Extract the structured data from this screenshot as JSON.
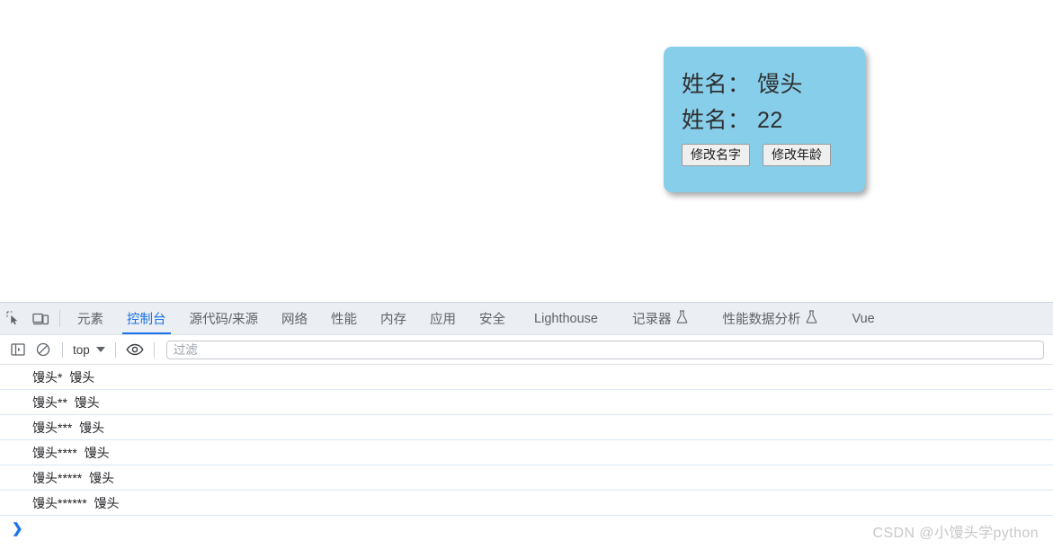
{
  "page": {
    "card": {
      "name_line": "姓名： 馒头",
      "age_line": "姓名： 22",
      "bg_color": "#87ceeb",
      "buttons": [
        {
          "label": "修改名字",
          "name": "change-name-button"
        },
        {
          "label": "修改年龄",
          "name": "change-age-button"
        }
      ]
    }
  },
  "devtools": {
    "toolbar_icons": [
      {
        "name": "inspect-element-icon"
      },
      {
        "name": "device-toolbar-icon"
      }
    ],
    "tabs": [
      {
        "label": "元素",
        "active": false,
        "flask": false
      },
      {
        "label": "控制台",
        "active": true,
        "flask": false
      },
      {
        "label": "源代码/来源",
        "active": false,
        "flask": false
      },
      {
        "label": "网络",
        "active": false,
        "flask": false
      },
      {
        "label": "性能",
        "active": false,
        "flask": false
      },
      {
        "label": "内存",
        "active": false,
        "flask": false
      },
      {
        "label": "应用",
        "active": false,
        "flask": false
      },
      {
        "label": "安全",
        "active": false,
        "flask": false
      },
      {
        "label": "Lighthouse",
        "active": false,
        "flask": false
      },
      {
        "label": "记录器",
        "active": false,
        "flask": true
      },
      {
        "label": "性能数据分析",
        "active": false,
        "flask": true
      },
      {
        "label": "Vue",
        "active": false,
        "flask": false
      }
    ],
    "console_toolbar": {
      "sidebar_toggle_icon": "console-sidebar-icon",
      "clear_console_icon": "clear-console-icon",
      "context_value": "top",
      "live_expression_icon": "eye-icon",
      "filter_placeholder": "过滤",
      "filter_value": ""
    },
    "console_logs": [
      "馒头*  馒头",
      "馒头**  馒头",
      "馒头***  馒头",
      "馒头****  馒头",
      "馒头*****  馒头",
      "馒头******  馒头"
    ],
    "prompt_symbol": "❯"
  },
  "watermark": "CSDN @小馒头学python",
  "accent_color": "#1a73e8"
}
